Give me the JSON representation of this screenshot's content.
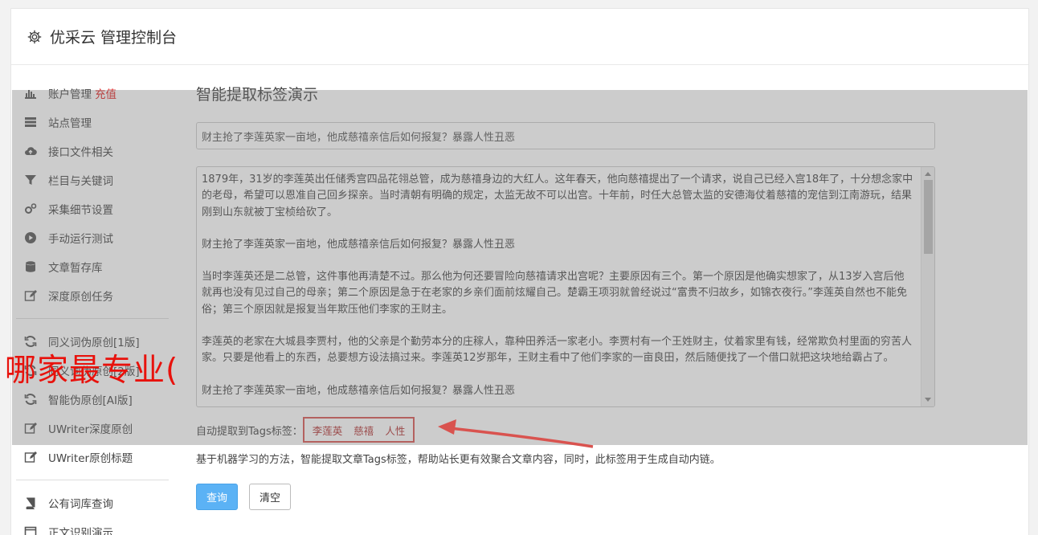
{
  "header": {
    "title": "优采云 管理控制台",
    "icon": "gear-icon"
  },
  "sidebar": {
    "items": [
      {
        "label": "账户管理",
        "badge": "充值",
        "icon": "bar-chart-icon"
      },
      {
        "label": "站点管理",
        "icon": "server-icon"
      },
      {
        "label": "接口文件相关",
        "icon": "cloud-upload-icon"
      },
      {
        "label": "栏目与关键词",
        "icon": "filter-icon"
      },
      {
        "label": "采集细节设置",
        "icon": "cogs-icon"
      },
      {
        "label": "手动运行测试",
        "icon": "play-circle-icon"
      },
      {
        "label": "文章暂存库",
        "icon": "database-icon"
      },
      {
        "label": "深度原创任务",
        "icon": "edit-icon"
      }
    ],
    "items2": [
      {
        "label": "同义词伪原创[1版]",
        "icon": "refresh-icon"
      },
      {
        "label": "同义词伪原创[2版]",
        "icon": "refresh-icon"
      },
      {
        "label": "智能伪原创[AI版]",
        "icon": "refresh-icon"
      },
      {
        "label": "UWriter深度原创",
        "icon": "edit-icon"
      },
      {
        "label": "UWriter原创标题",
        "icon": "edit-icon"
      }
    ],
    "items3": [
      {
        "label": "公有词库查询",
        "icon": "book-icon"
      },
      {
        "label": "正文识别演示",
        "icon": "window-icon"
      }
    ]
  },
  "main": {
    "heading": "智能提取标签演示",
    "title_value": "财主抢了李莲英家一亩地，他成慈禧亲信后如何报复？暴露人性丑恶",
    "article": [
      "1879年，31岁的李莲英出任储秀宫四品花翎总管，成为慈禧身边的大红人。这年春天，他向慈禧提出了一个请求，说自己已经入宫18年了，十分想念家中的老母，希望可以恩准自己回乡探亲。当时清朝有明确的规定，太监无故不可以出宫。十年前，时任大总管太监的安德海仗着慈禧的宠信到江南游玩，结果刚到山东就被丁宝桢给砍了。",
      "财主抢了李莲英家一亩地，他成慈禧亲信后如何报复？暴露人性丑恶",
      "当时李莲英还是二总管，这件事他再清楚不过。那么他为何还要冒险向慈禧请求出宫呢？主要原因有三个。第一个原因是他确实想家了，从13岁入宫后他就再也没有见过自己的母亲；第二个原因是急于在老家的乡亲们面前炫耀自己。楚霸王项羽就曾经说过“富贵不归故乡，如锦衣夜行。”李莲英自然也不能免俗；第三个原因就是报复当年欺压他们李家的王财主。",
      "李莲英的老家在大城县李贾村，他的父亲是个勤劳本分的庄稼人，靠种田养活一家老小。李贾村有一个王姓财主，仗着家里有钱，经常欺负村里面的穷苦人家。只要是他看上的东西，总要想方设法搞过来。李莲英12岁那年，王财主看中了他们李家的一亩良田，然后随便找了一个借口就把这块地给霸占了。",
      "财主抢了李莲英家一亩地，他成慈禧亲信后如何报复？暴露人性丑恶"
    ],
    "tags_label": "自动提取到Tags标签：",
    "tags": [
      "李莲英",
      "慈禧",
      "人性"
    ],
    "description": "基于机器学习的方法，智能提取文章Tags标签，帮助站长更有效聚合文章内容，同时，此标签用于生成自动内链。",
    "query_button": "查询",
    "clear_button": "清空"
  },
  "watermark": "哪家最专业(",
  "colors": {
    "primary": "#5bb2f5",
    "badge": "#e02020",
    "highlight": "#d9534f",
    "watermark": "#e8120c"
  }
}
